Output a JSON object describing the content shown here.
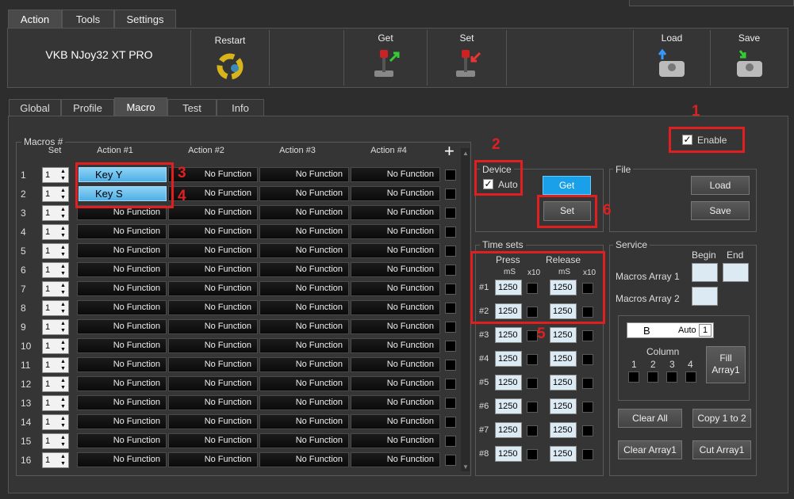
{
  "window_tabs": [
    "Action",
    "Tools",
    "Settings"
  ],
  "device_name": "VKB NJoy32 XT PRO",
  "toolbar": {
    "restart": "Restart",
    "get": "Get",
    "set": "Set",
    "load": "Load",
    "save": "Save"
  },
  "sub_tabs": [
    "Global",
    "Profile",
    "Macro",
    "Test",
    "Info"
  ],
  "macros": {
    "title": "Macros #",
    "headers": {
      "set": "Set",
      "a1": "Action #1",
      "a2": "Action #2",
      "a3": "Action #3",
      "a4": "Action #4",
      "add": "+"
    },
    "rows": [
      {
        "n": "1",
        "set": "1",
        "a": [
          "Key Y",
          "No Function",
          "No Function",
          "No Function"
        ]
      },
      {
        "n": "2",
        "set": "1",
        "a": [
          "Key S",
          "No Function",
          "No Function",
          "No Function"
        ]
      },
      {
        "n": "3",
        "set": "1",
        "a": [
          "No Function",
          "No Function",
          "No Function",
          "No Function"
        ]
      },
      {
        "n": "4",
        "set": "1",
        "a": [
          "No Function",
          "No Function",
          "No Function",
          "No Function"
        ]
      },
      {
        "n": "5",
        "set": "1",
        "a": [
          "No Function",
          "No Function",
          "No Function",
          "No Function"
        ]
      },
      {
        "n": "6",
        "set": "1",
        "a": [
          "No Function",
          "No Function",
          "No Function",
          "No Function"
        ]
      },
      {
        "n": "7",
        "set": "1",
        "a": [
          "No Function",
          "No Function",
          "No Function",
          "No Function"
        ]
      },
      {
        "n": "8",
        "set": "1",
        "a": [
          "No Function",
          "No Function",
          "No Function",
          "No Function"
        ]
      },
      {
        "n": "9",
        "set": "1",
        "a": [
          "No Function",
          "No Function",
          "No Function",
          "No Function"
        ]
      },
      {
        "n": "10",
        "set": "1",
        "a": [
          "No Function",
          "No Function",
          "No Function",
          "No Function"
        ]
      },
      {
        "n": "11",
        "set": "1",
        "a": [
          "No Function",
          "No Function",
          "No Function",
          "No Function"
        ]
      },
      {
        "n": "12",
        "set": "1",
        "a": [
          "No Function",
          "No Function",
          "No Function",
          "No Function"
        ]
      },
      {
        "n": "13",
        "set": "1",
        "a": [
          "No Function",
          "No Function",
          "No Function",
          "No Function"
        ]
      },
      {
        "n": "14",
        "set": "1",
        "a": [
          "No Function",
          "No Function",
          "No Function",
          "No Function"
        ]
      },
      {
        "n": "15",
        "set": "1",
        "a": [
          "No Function",
          "No Function",
          "No Function",
          "No Function"
        ]
      },
      {
        "n": "16",
        "set": "1",
        "a": [
          "No Function",
          "No Function",
          "No Function",
          "No Function"
        ]
      }
    ]
  },
  "enable": {
    "label": "Enable",
    "checked": "✓"
  },
  "device": {
    "title": "Device",
    "auto": "Auto",
    "checked": "✓",
    "get": "Get",
    "set": "Set"
  },
  "file": {
    "title": "File",
    "load": "Load",
    "save": "Save"
  },
  "timesets": {
    "title": "Time sets",
    "press": "Press",
    "release": "Release",
    "ms": "mS",
    "x10": "x10",
    "rows": [
      {
        "n": "#1",
        "press": "1250",
        "release": "1250"
      },
      {
        "n": "#2",
        "press": "1250",
        "release": "1250"
      },
      {
        "n": "#3",
        "press": "1250",
        "release": "1250"
      },
      {
        "n": "#4",
        "press": "1250",
        "release": "1250"
      },
      {
        "n": "#5",
        "press": "1250",
        "release": "1250"
      },
      {
        "n": "#6",
        "press": "1250",
        "release": "1250"
      },
      {
        "n": "#7",
        "press": "1250",
        "release": "1250"
      },
      {
        "n": "#8",
        "press": "1250",
        "release": "1250"
      }
    ]
  },
  "service": {
    "title": "Service",
    "begin": "Begin",
    "end": "End",
    "array1": "Macros Array 1",
    "array2": "Macros Array 2",
    "key": "B",
    "auto": "Auto",
    "count": "1",
    "column": "Column",
    "cols": [
      "1",
      "2",
      "3",
      "4"
    ],
    "fill": "Fill Array1",
    "clear_all": "Clear All",
    "copy": "Copy 1 to 2",
    "clear_array": "Clear Array1",
    "cut_array": "Cut Array1"
  },
  "annotations": [
    "1",
    "2",
    "3",
    "4",
    "5",
    "6"
  ],
  "colors": {
    "annotation": "#e02020",
    "key_fill": "#4fb0e6",
    "get_button": "#1aa0e8"
  }
}
